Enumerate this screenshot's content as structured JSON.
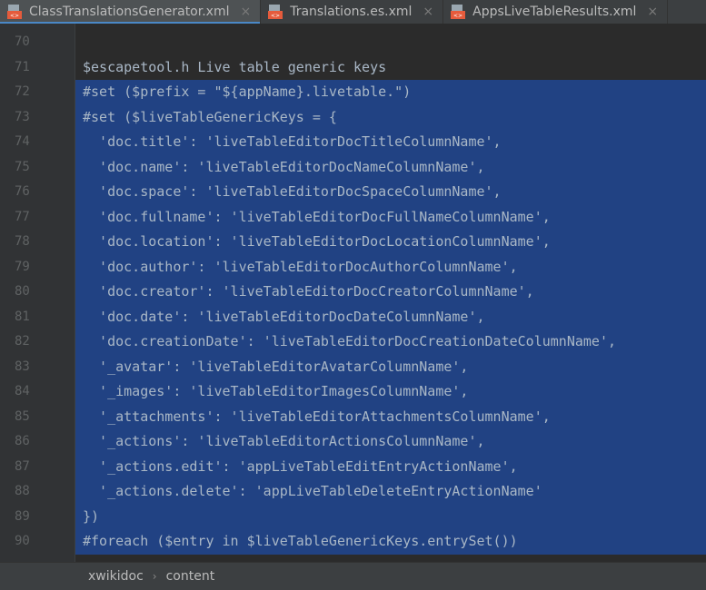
{
  "tabs": [
    {
      "label": "ClassTranslationsGenerator.xml",
      "active": true
    },
    {
      "label": "Translations.es.xml",
      "active": false
    },
    {
      "label": "AppsLiveTableResults.xml",
      "active": false
    }
  ],
  "lines": [
    {
      "num": "70",
      "text": "",
      "selected": false
    },
    {
      "num": "71",
      "text": "$escapetool.h Live table generic keys",
      "selected": false
    },
    {
      "num": "72",
      "text": "#set ($prefix = \"${appName}.livetable.\")",
      "selected": true
    },
    {
      "num": "73",
      "text": "#set ($liveTableGenericKeys = {",
      "selected": true
    },
    {
      "num": "74",
      "text": "  'doc.title': 'liveTableEditorDocTitleColumnName',",
      "selected": true
    },
    {
      "num": "75",
      "text": "  'doc.name': 'liveTableEditorDocNameColumnName',",
      "selected": true
    },
    {
      "num": "76",
      "text": "  'doc.space': 'liveTableEditorDocSpaceColumnName',",
      "selected": true
    },
    {
      "num": "77",
      "text": "  'doc.fullname': 'liveTableEditorDocFullNameColumnName',",
      "selected": true
    },
    {
      "num": "78",
      "text": "  'doc.location': 'liveTableEditorDocLocationColumnName',",
      "selected": true
    },
    {
      "num": "79",
      "text": "  'doc.author': 'liveTableEditorDocAuthorColumnName',",
      "selected": true
    },
    {
      "num": "80",
      "text": "  'doc.creator': 'liveTableEditorDocCreatorColumnName',",
      "selected": true
    },
    {
      "num": "81",
      "text": "  'doc.date': 'liveTableEditorDocDateColumnName',",
      "selected": true
    },
    {
      "num": "82",
      "text": "  'doc.creationDate': 'liveTableEditorDocCreationDateColumnName',",
      "selected": true
    },
    {
      "num": "83",
      "text": "  '_avatar': 'liveTableEditorAvatarColumnName',",
      "selected": true
    },
    {
      "num": "84",
      "text": "  '_images': 'liveTableEditorImagesColumnName',",
      "selected": true
    },
    {
      "num": "85",
      "text": "  '_attachments': 'liveTableEditorAttachmentsColumnName',",
      "selected": true
    },
    {
      "num": "86",
      "text": "  '_actions': 'liveTableEditorActionsColumnName',",
      "selected": true
    },
    {
      "num": "87",
      "text": "  '_actions.edit': 'appLiveTableEditEntryActionName',",
      "selected": true
    },
    {
      "num": "88",
      "text": "  '_actions.delete': 'appLiveTableDeleteEntryActionName'",
      "selected": true
    },
    {
      "num": "89",
      "text": "})",
      "selected": true
    },
    {
      "num": "90",
      "text": "#foreach ($entry in $liveTableGenericKeys.entrySet())",
      "selected": true
    }
  ],
  "breadcrumb": {
    "item1": "xwikidoc",
    "item2": "content"
  },
  "colors": {
    "selection": "#214283",
    "background": "#2b2b2b",
    "text": "#a9b7c6"
  }
}
